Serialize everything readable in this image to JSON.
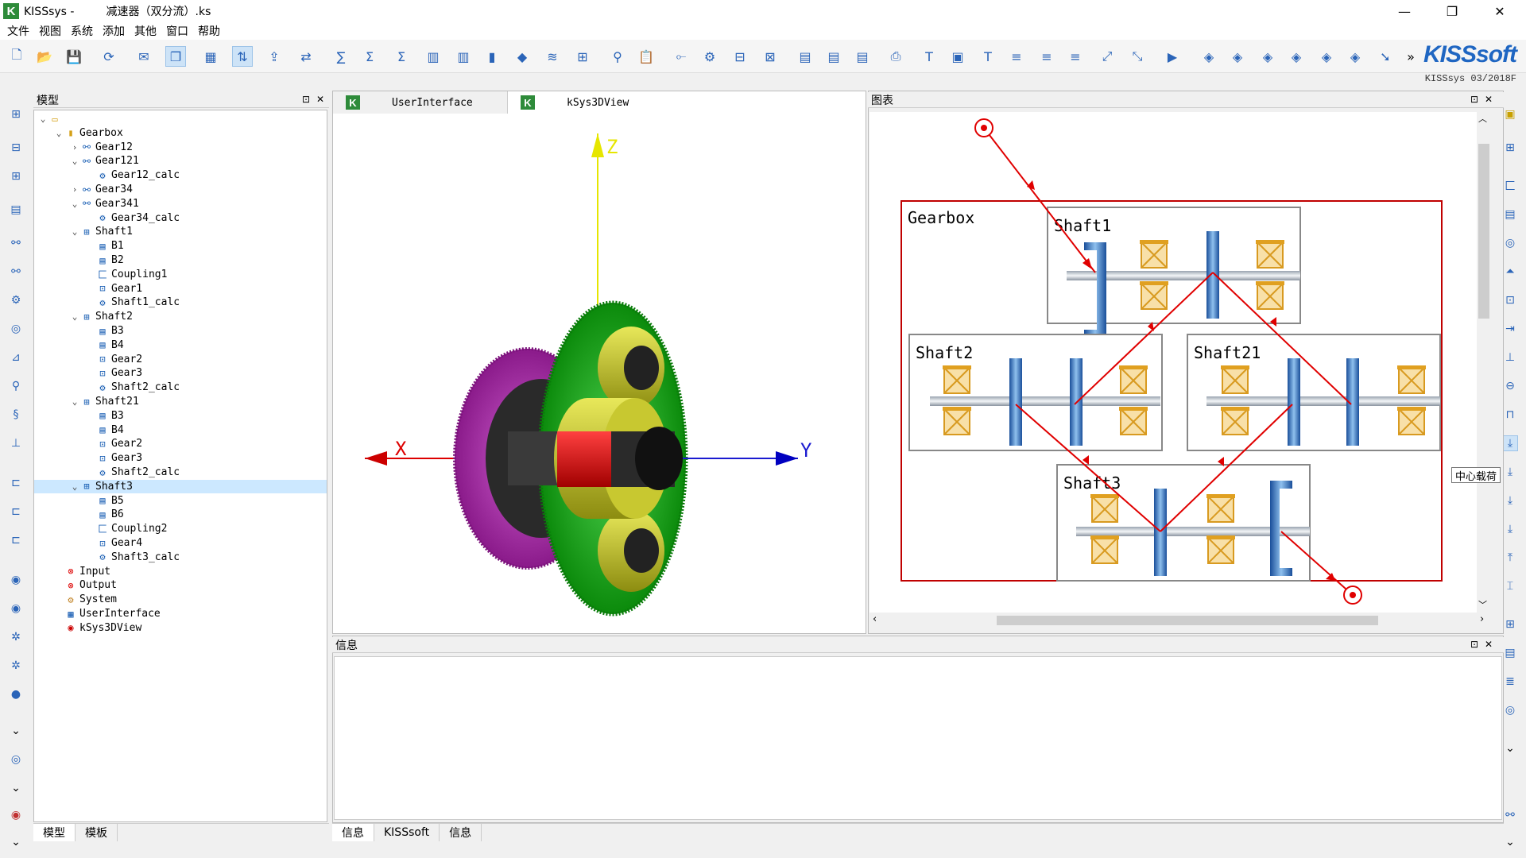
{
  "window": {
    "title": "KISSsys -         减速器（双分流）.ks",
    "logo_letter": "K",
    "minimize": "—",
    "maximize": "❐",
    "close": "✕"
  },
  "menu": [
    "文件",
    "视图",
    "系统",
    "添加",
    "其他",
    "窗口",
    "帮助"
  ],
  "brand": {
    "name": "KISSsoft",
    "version": "KISSsys 03/2018F",
    "chevron": "»"
  },
  "model_panel": {
    "title": "模型",
    "pin": "⊡",
    "close": "✕"
  },
  "tree": {
    "root_expander": "⌄",
    "items": [
      {
        "label": "Gearbox",
        "icon": "folder-icon",
        "glyph": "▮"
      },
      {
        "label": "Gear12",
        "icon": "gear-pair-icon",
        "glyph": "⚯"
      },
      {
        "label": "Gear121",
        "icon": "gear-pair-icon",
        "glyph": "⚯"
      },
      {
        "label": "Gear12_calc",
        "icon": "calc-icon",
        "glyph": "⚙"
      },
      {
        "label": "Gear34",
        "icon": "gear-pair-icon",
        "glyph": "⚯"
      },
      {
        "label": "Gear341",
        "icon": "gear-pair-icon",
        "glyph": "⚯"
      },
      {
        "label": "Gear34_calc",
        "icon": "calc-icon",
        "glyph": "⚙"
      },
      {
        "label": "Shaft1",
        "icon": "shaft-icon",
        "glyph": "⊞"
      },
      {
        "label": "B1",
        "icon": "bearing-icon",
        "glyph": "▤"
      },
      {
        "label": "B2",
        "icon": "bearing-icon",
        "glyph": "▤"
      },
      {
        "label": "Coupling1",
        "icon": "coupling-icon",
        "glyph": "匚"
      },
      {
        "label": "Gear1",
        "icon": "gear-icon",
        "glyph": "⊡"
      },
      {
        "label": "Shaft1_calc",
        "icon": "calc-icon",
        "glyph": "⚙"
      },
      {
        "label": "Shaft2",
        "icon": "shaft-icon",
        "glyph": "⊞"
      },
      {
        "label": "B3",
        "icon": "bearing-icon",
        "glyph": "▤"
      },
      {
        "label": "B4",
        "icon": "bearing-icon",
        "glyph": "▤"
      },
      {
        "label": "Gear2",
        "icon": "gear-icon",
        "glyph": "⊡"
      },
      {
        "label": "Gear3",
        "icon": "gear-icon",
        "glyph": "⊡"
      },
      {
        "label": "Shaft2_calc",
        "icon": "calc-icon",
        "glyph": "⚙"
      },
      {
        "label": "Shaft21",
        "icon": "shaft-icon",
        "glyph": "⊞"
      },
      {
        "label": "B3",
        "icon": "bearing-icon",
        "glyph": "▤"
      },
      {
        "label": "B4",
        "icon": "bearing-icon",
        "glyph": "▤"
      },
      {
        "label": "Gear2",
        "icon": "gear-icon",
        "glyph": "⊡"
      },
      {
        "label": "Gear3",
        "icon": "gear-icon",
        "glyph": "⊡"
      },
      {
        "label": "Shaft2_calc",
        "icon": "calc-icon",
        "glyph": "⚙"
      },
      {
        "label": "Shaft3",
        "icon": "shaft-icon",
        "glyph": "⊞"
      },
      {
        "label": "B5",
        "icon": "bearing-icon",
        "glyph": "▤"
      },
      {
        "label": "B6",
        "icon": "bearing-icon",
        "glyph": "▤"
      },
      {
        "label": "Coupling2",
        "icon": "coupling-icon",
        "glyph": "匚"
      },
      {
        "label": "Gear4",
        "icon": "gear-icon",
        "glyph": "⊡"
      },
      {
        "label": "Shaft3_calc",
        "icon": "calc-icon",
        "glyph": "⚙"
      },
      {
        "label": "Input",
        "icon": "input-icon",
        "glyph": "⊗"
      },
      {
        "label": "Output",
        "icon": "output-icon",
        "glyph": "⊗"
      },
      {
        "label": "System",
        "icon": "system-icon",
        "glyph": "⚙"
      },
      {
        "label": "UserInterface",
        "icon": "grid-icon",
        "glyph": "▦"
      },
      {
        "label": "kSys3DView",
        "icon": "view3d-icon",
        "glyph": "◉"
      }
    ]
  },
  "left_tabs": [
    "模型",
    "模板"
  ],
  "doc_tabs": [
    {
      "label": "UserInterface",
      "logo": "K"
    },
    {
      "label": "kSys3DView",
      "logo": "K"
    }
  ],
  "view3d": {
    "axis_x": "X",
    "axis_y": "Y",
    "axis_z": "Z"
  },
  "diagram_panel": {
    "title": "图表",
    "gearbox_label": "Gearbox",
    "shafts": [
      "Shaft1",
      "Shaft2",
      "Shaft21",
      "Shaft3"
    ]
  },
  "info_panel": {
    "title": "信息"
  },
  "bottom_tabs": [
    "信息",
    "KISSsoft",
    "信息"
  ],
  "tooltip": "中心载荷",
  "colors": {
    "accent": "#1f66c2",
    "flow": "#e00000",
    "gearbox_border": "#c00000"
  }
}
